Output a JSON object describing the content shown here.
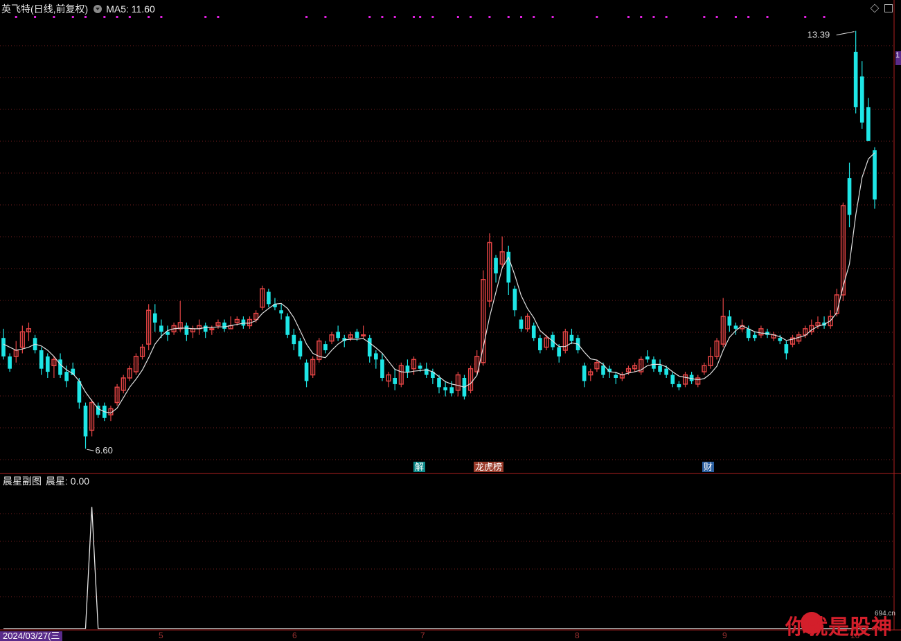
{
  "header": {
    "title": "英飞特(日线,前复权)",
    "ma_label": "MA5: 11.60"
  },
  "sub_header": {
    "title": "晨星副图",
    "value_label": "晨星: 0.00"
  },
  "price_labels": {
    "high": "13.39",
    "low": "6.60"
  },
  "markers": [
    {
      "text": "解",
      "color": "#0d8a8a"
    },
    {
      "text": "龙虎榜",
      "color": "#9a3b2a"
    },
    {
      "text": "财",
      "color": "#2a5fa0"
    }
  ],
  "date_label": "2024/03/27(三",
  "month_labels": [
    "5",
    "6",
    "7",
    "8",
    "9",
    "10"
  ],
  "watermark": "你就是股神",
  "watermark_site": "694.cn",
  "edge_tag": "1",
  "colors": {
    "up": "#e64545",
    "down": "#1ee6e6",
    "ma": "#e0e0e0",
    "grid": "#7a1f1f",
    "dots": "#e020e0"
  },
  "chart_data": [
    {
      "type": "candlestick",
      "title": "英飞特(日线,前复权)",
      "ylim": [
        6.4,
        13.6
      ],
      "annotations": [
        "13.39",
        "6.60"
      ],
      "series": [
        {
          "name": "MA5",
          "type": "line"
        }
      ],
      "ohlc": [
        [
          8.4,
          8.55,
          8.05,
          8.1
        ],
        [
          8.1,
          8.15,
          7.85,
          7.9
        ],
        [
          8.1,
          8.35,
          8.0,
          8.2
        ],
        [
          8.25,
          8.6,
          8.15,
          8.5
        ],
        [
          8.5,
          8.65,
          8.35,
          8.55
        ],
        [
          8.4,
          8.45,
          8.15,
          8.2
        ],
        [
          8.2,
          8.25,
          7.8,
          7.9
        ],
        [
          8.1,
          8.15,
          7.75,
          7.85
        ],
        [
          7.95,
          8.1,
          7.75,
          8.05
        ],
        [
          8.05,
          8.15,
          7.75,
          7.8
        ],
        [
          7.85,
          7.95,
          7.6,
          7.7
        ],
        [
          7.9,
          8.0,
          7.8,
          7.8
        ],
        [
          7.7,
          7.75,
          7.25,
          7.35
        ],
        [
          7.3,
          7.35,
          6.6,
          6.8
        ],
        [
          6.9,
          7.4,
          6.8,
          7.35
        ],
        [
          7.3,
          7.35,
          7.1,
          7.15
        ],
        [
          7.3,
          7.35,
          7.05,
          7.1
        ],
        [
          7.15,
          7.3,
          7.05,
          7.25
        ],
        [
          7.35,
          7.65,
          7.3,
          7.6
        ],
        [
          7.55,
          7.8,
          7.5,
          7.75
        ],
        [
          7.75,
          7.95,
          7.7,
          7.9
        ],
        [
          7.85,
          8.15,
          7.8,
          8.1
        ],
        [
          8.1,
          8.3,
          8.05,
          8.25
        ],
        [
          8.3,
          8.95,
          8.2,
          8.85
        ],
        [
          8.8,
          8.95,
          8.5,
          8.65
        ],
        [
          8.6,
          8.7,
          8.4,
          8.5
        ],
        [
          8.5,
          8.6,
          8.35,
          8.45
        ],
        [
          8.5,
          8.65,
          8.45,
          8.6
        ],
        [
          8.55,
          9.0,
          8.5,
          8.65
        ],
        [
          8.6,
          8.65,
          8.35,
          8.45
        ],
        [
          8.5,
          8.6,
          8.4,
          8.55
        ],
        [
          8.55,
          8.7,
          8.45,
          8.6
        ],
        [
          8.6,
          8.65,
          8.4,
          8.5
        ],
        [
          8.55,
          8.6,
          8.45,
          8.55
        ],
        [
          8.6,
          8.7,
          8.55,
          8.65
        ],
        [
          8.65,
          8.7,
          8.5,
          8.55
        ],
        [
          8.55,
          8.75,
          8.55,
          8.6
        ],
        [
          8.65,
          8.75,
          8.6,
          8.7
        ],
        [
          8.7,
          8.75,
          8.55,
          8.6
        ],
        [
          8.6,
          8.75,
          8.55,
          8.7
        ],
        [
          8.7,
          8.85,
          8.65,
          8.8
        ],
        [
          8.9,
          9.25,
          8.85,
          9.2
        ],
        [
          9.15,
          9.2,
          8.9,
          8.95
        ],
        [
          8.95,
          9.05,
          8.85,
          8.9
        ],
        [
          8.85,
          8.95,
          8.7,
          8.8
        ],
        [
          8.75,
          8.8,
          8.4,
          8.45
        ],
        [
          8.45,
          8.55,
          8.2,
          8.3
        ],
        [
          8.35,
          8.4,
          8.05,
          8.1
        ],
        [
          8.0,
          8.05,
          7.6,
          7.7
        ],
        [
          7.8,
          8.1,
          7.75,
          8.05
        ],
        [
          8.05,
          8.4,
          8.0,
          8.35
        ],
        [
          8.3,
          8.35,
          8.15,
          8.2
        ],
        [
          8.35,
          8.5,
          8.3,
          8.45
        ],
        [
          8.5,
          8.6,
          8.35,
          8.4
        ],
        [
          8.4,
          8.45,
          8.25,
          8.35
        ],
        [
          8.4,
          8.5,
          8.35,
          8.45
        ],
        [
          8.5,
          8.55,
          8.35,
          8.4
        ],
        [
          8.45,
          8.6,
          8.4,
          8.45
        ],
        [
          8.4,
          8.45,
          8.0,
          8.1
        ],
        [
          8.15,
          8.2,
          7.9,
          8.05
        ],
        [
          8.05,
          8.15,
          7.7,
          7.75
        ],
        [
          7.7,
          7.85,
          7.6,
          7.8
        ],
        [
          7.75,
          7.9,
          7.55,
          7.65
        ],
        [
          7.65,
          8.0,
          7.6,
          7.95
        ],
        [
          7.95,
          8.05,
          7.75,
          7.85
        ],
        [
          7.9,
          8.1,
          7.8,
          8.05
        ],
        [
          7.95,
          8.0,
          7.85,
          7.9
        ],
        [
          7.9,
          8.0,
          7.75,
          7.8
        ],
        [
          7.85,
          7.9,
          7.65,
          7.75
        ],
        [
          7.75,
          7.8,
          7.5,
          7.6
        ],
        [
          7.6,
          7.7,
          7.45,
          7.55
        ],
        [
          7.6,
          7.7,
          7.45,
          7.5
        ],
        [
          7.55,
          7.85,
          7.45,
          7.8
        ],
        [
          7.75,
          7.8,
          7.4,
          7.45
        ],
        [
          7.55,
          7.95,
          7.5,
          7.9
        ],
        [
          7.85,
          8.2,
          7.8,
          8.1
        ],
        [
          8.0,
          9.5,
          7.95,
          9.35
        ],
        [
          9.0,
          10.1,
          8.9,
          9.95
        ],
        [
          9.7,
          9.75,
          9.3,
          9.45
        ],
        [
          9.6,
          10.05,
          9.55,
          9.8
        ],
        [
          9.8,
          9.9,
          9.1,
          9.3
        ],
        [
          9.2,
          9.25,
          8.75,
          8.85
        ],
        [
          8.7,
          8.75,
          8.5,
          8.55
        ],
        [
          8.55,
          8.8,
          8.5,
          8.75
        ],
        [
          8.6,
          8.65,
          8.35,
          8.4
        ],
        [
          8.4,
          8.45,
          8.15,
          8.2
        ],
        [
          8.25,
          8.45,
          8.2,
          8.4
        ],
        [
          8.45,
          8.5,
          8.2,
          8.25
        ],
        [
          8.25,
          8.3,
          8.0,
          8.1
        ],
        [
          8.2,
          8.55,
          8.15,
          8.5
        ],
        [
          8.45,
          8.55,
          8.3,
          8.35
        ],
        [
          8.4,
          8.45,
          8.15,
          8.2
        ],
        [
          7.95,
          8.0,
          7.6,
          7.7
        ],
        [
          7.8,
          7.9,
          7.7,
          7.85
        ],
        [
          7.9,
          8.05,
          7.85,
          8.0
        ],
        [
          7.95,
          8.0,
          7.75,
          7.8
        ],
        [
          7.9,
          7.95,
          7.75,
          7.85
        ],
        [
          7.8,
          7.85,
          7.65,
          7.75
        ],
        [
          7.75,
          7.85,
          7.7,
          7.8
        ],
        [
          7.85,
          7.95,
          7.8,
          7.9
        ],
        [
          7.9,
          8.0,
          7.85,
          7.95
        ],
        [
          7.85,
          8.1,
          7.8,
          8.05
        ],
        [
          8.1,
          8.2,
          8.0,
          8.05
        ],
        [
          8.05,
          8.1,
          7.85,
          7.9
        ],
        [
          7.95,
          8.05,
          7.8,
          7.85
        ],
        [
          7.9,
          7.95,
          7.75,
          7.8
        ],
        [
          7.8,
          7.85,
          7.6,
          7.65
        ],
        [
          7.65,
          7.7,
          7.55,
          7.6
        ],
        [
          7.65,
          7.85,
          7.6,
          7.8
        ],
        [
          7.8,
          7.85,
          7.65,
          7.7
        ],
        [
          7.65,
          7.8,
          7.6,
          7.75
        ],
        [
          7.85,
          8.0,
          7.8,
          7.95
        ],
        [
          7.95,
          8.25,
          7.9,
          8.1
        ],
        [
          8.1,
          8.4,
          8.05,
          8.35
        ],
        [
          8.3,
          9.05,
          8.25,
          8.75
        ],
        [
          8.75,
          8.85,
          8.5,
          8.6
        ],
        [
          8.6,
          8.65,
          8.45,
          8.55
        ],
        [
          8.55,
          8.7,
          8.5,
          8.6
        ],
        [
          8.55,
          8.6,
          8.35,
          8.4
        ],
        [
          8.45,
          8.5,
          8.35,
          8.4
        ],
        [
          8.45,
          8.6,
          8.4,
          8.55
        ],
        [
          8.5,
          8.55,
          8.4,
          8.45
        ],
        [
          8.4,
          8.5,
          8.35,
          8.45
        ],
        [
          8.4,
          8.45,
          8.3,
          8.35
        ],
        [
          8.3,
          8.35,
          8.05,
          8.15
        ],
        [
          8.3,
          8.45,
          8.25,
          8.4
        ],
        [
          8.35,
          8.5,
          8.3,
          8.45
        ],
        [
          8.45,
          8.6,
          8.4,
          8.55
        ],
        [
          8.5,
          8.7,
          8.45,
          8.6
        ],
        [
          8.6,
          8.75,
          8.55,
          8.65
        ],
        [
          8.65,
          8.75,
          8.55,
          8.6
        ],
        [
          8.6,
          8.85,
          8.55,
          8.75
        ],
        [
          8.8,
          9.2,
          8.75,
          9.1
        ],
        [
          9.1,
          10.6,
          9.0,
          10.55
        ],
        [
          11.0,
          11.25,
          10.2,
          10.4
        ],
        [
          13.05,
          13.39,
          12.05,
          12.15
        ],
        [
          12.65,
          12.9,
          11.8,
          11.9
        ],
        [
          12.15,
          12.3,
          11.6,
          11.6
        ],
        [
          11.45,
          11.5,
          10.5,
          10.65
        ]
      ],
      "ma5": [
        8.3,
        8.25,
        8.2,
        8.22,
        8.25,
        8.3,
        8.27,
        8.2,
        8.1,
        7.97,
        7.88,
        7.82,
        7.7,
        7.52,
        7.38,
        7.25,
        7.2,
        7.18,
        7.26,
        7.43,
        7.6,
        7.73,
        7.88,
        8.08,
        8.3,
        8.43,
        8.52,
        8.55,
        8.56,
        8.56,
        8.55,
        8.55,
        8.57,
        8.57,
        8.58,
        8.58,
        8.6,
        8.62,
        8.64,
        8.64,
        8.68,
        8.8,
        8.88,
        8.95,
        8.96,
        8.88,
        8.73,
        8.52,
        8.3,
        8.15,
        8.1,
        8.08,
        8.2,
        8.3,
        8.37,
        8.38,
        8.38,
        8.39,
        8.32,
        8.24,
        8.15,
        8.02,
        7.89,
        7.85,
        7.84,
        7.86,
        7.87,
        7.88,
        7.85,
        7.77,
        7.69,
        7.65,
        7.63,
        7.6,
        7.66,
        7.79,
        8.25,
        8.74,
        9.14,
        9.54,
        9.71,
        9.42,
        9.09,
        8.88,
        8.73,
        8.52,
        8.43,
        8.35,
        8.26,
        8.26,
        8.32,
        8.3,
        8.17,
        8.06,
        8.04,
        7.97,
        7.85,
        7.84,
        7.8,
        7.83,
        7.85,
        7.88,
        7.95,
        7.97,
        7.97,
        7.93,
        7.85,
        7.78,
        7.76,
        7.74,
        7.72,
        7.74,
        7.82,
        7.94,
        8.2,
        8.41,
        8.52,
        8.6,
        8.55,
        8.5,
        8.48,
        8.47,
        8.45,
        8.42,
        8.36,
        8.38,
        8.41,
        8.44,
        8.53,
        8.59,
        8.62,
        8.68,
        8.81,
        9.24,
        9.6,
        10.4,
        11.01,
        11.31,
        11.41
      ],
      "signal_dots_x": [
        2,
        5,
        8,
        11,
        13,
        16,
        18,
        20,
        23,
        25,
        32,
        34,
        48,
        51,
        58,
        60,
        62,
        65,
        66,
        68,
        72,
        74,
        77,
        80,
        82,
        84,
        87,
        94,
        99,
        101,
        103,
        105,
        111,
        113,
        116,
        118,
        121,
        127,
        130
      ]
    },
    {
      "type": "line",
      "title": "晨星副图",
      "ylim": [
        0,
        1.15
      ],
      "series": [
        {
          "name": "晨星",
          "values_note": "",
          "spike_index": 14,
          "spike_value": 1.0
        }
      ],
      "current_value": 0.0
    }
  ]
}
